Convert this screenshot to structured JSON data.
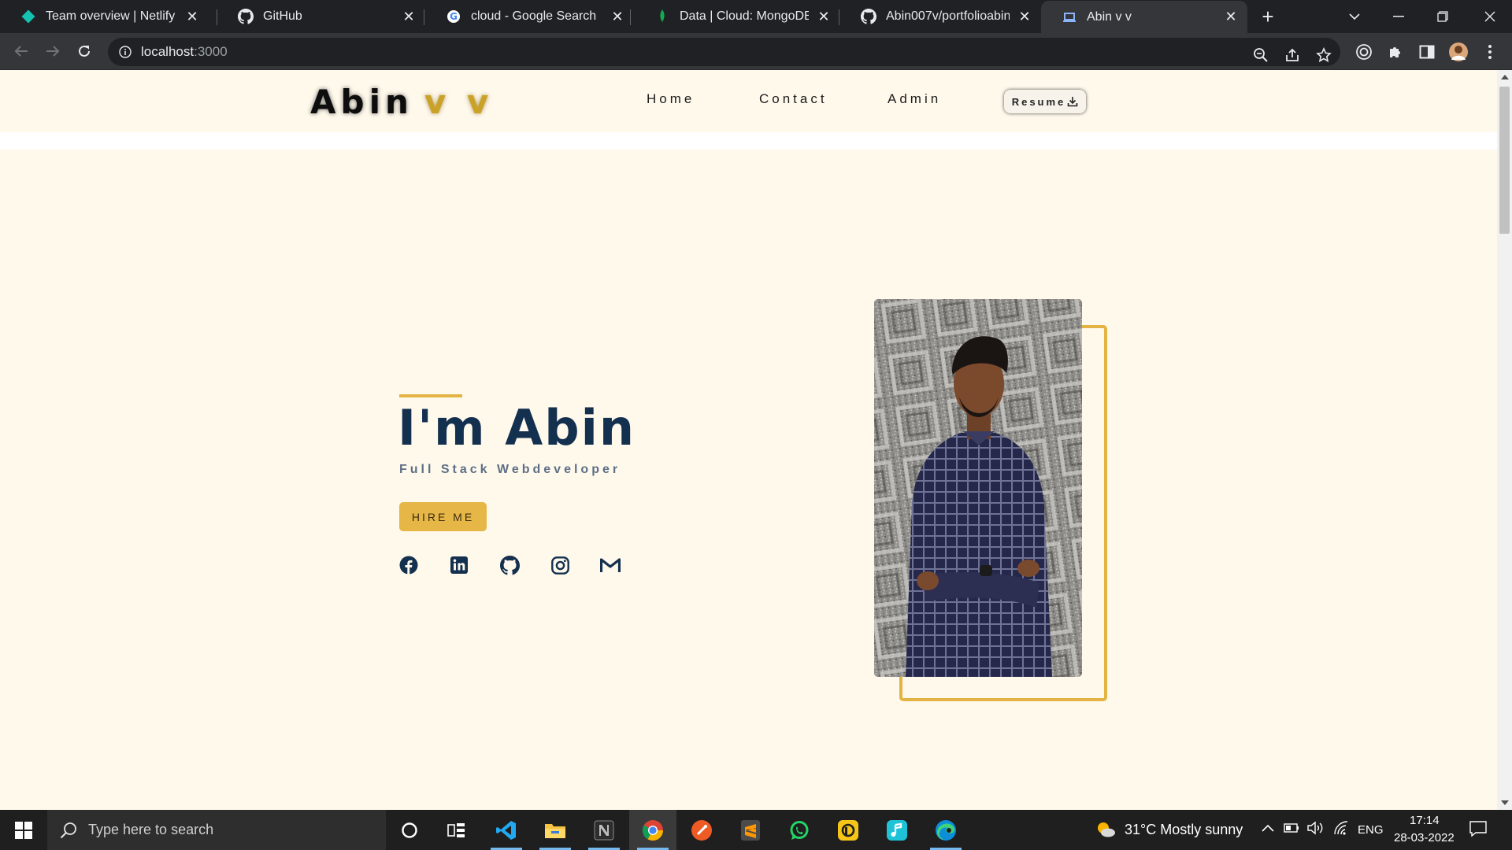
{
  "browser": {
    "tabs": [
      {
        "title": "Team overview | Netlify",
        "icon": "netlify-icon"
      },
      {
        "title": "GitHub",
        "icon": "github-icon"
      },
      {
        "title": "cloud - Google Search",
        "icon": "google-icon"
      },
      {
        "title": "Data | Cloud: MongoDB Clo",
        "icon": "mongodb-icon"
      },
      {
        "title": "Abin007v/portfolioabin",
        "icon": "github-icon"
      },
      {
        "title": "Abin v v",
        "icon": "laptop-icon",
        "active": true
      }
    ],
    "url_host": "localhost",
    "url_port": ":3000"
  },
  "site": {
    "logo_first": "Abin",
    "logo_last": "v v",
    "nav": {
      "home": "Home",
      "contact": "Contact",
      "admin": "Admin",
      "resume": "Resume"
    },
    "hero": {
      "title": "I'm Abin",
      "subtitle": "Full Stack Webdeveloper",
      "cta": "HIRE ME"
    },
    "social_icons": [
      "facebook-icon",
      "linkedin-icon",
      "github-icon",
      "instagram-icon",
      "gmail-icon"
    ]
  },
  "colors": {
    "page_bg": "#fff9ec",
    "accent": "#e3b443",
    "title": "#14304f",
    "subtitle": "#5d6f86"
  },
  "taskbar": {
    "search_placeholder": "Type here to search",
    "weather": "31°C  Mostly sunny",
    "lang": "ENG",
    "time": "17:14",
    "date": "28-03-2022"
  }
}
